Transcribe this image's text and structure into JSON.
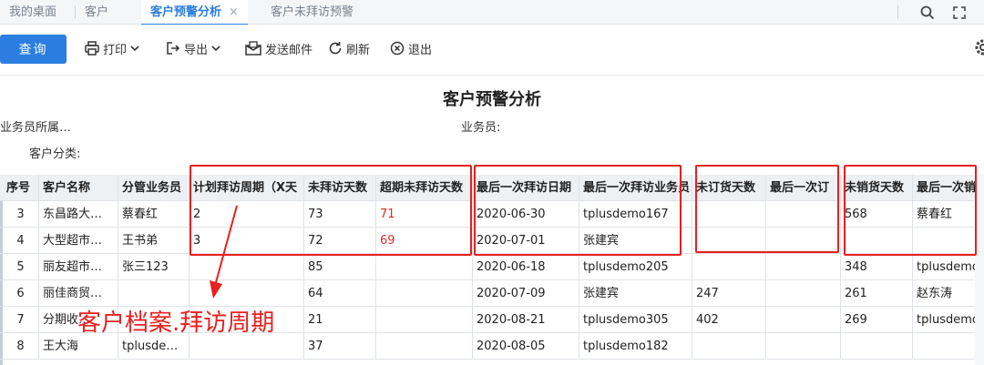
{
  "tabs": [
    {
      "label": "我的桌面",
      "active": false
    },
    {
      "label": "客户",
      "active": false
    },
    {
      "label": "客户预警分析",
      "active": true,
      "closable": true
    },
    {
      "label": "客户未拜访预警",
      "active": false
    }
  ],
  "tab_close_glyph": "×",
  "toolbar": {
    "query_label": "查询",
    "print_label": "打印",
    "export_label": "导出",
    "send_mail_label": "发送邮件",
    "refresh_label": "刷新",
    "exit_label": "退出"
  },
  "report": {
    "title": "客户预警分析",
    "filter_salesman_dept": "业务员所属…",
    "filter_salesman": "业务员:",
    "filter_customer_category": "客户分类:"
  },
  "table": {
    "headers": [
      "序号",
      "客户名称",
      "分管业务员",
      "计划拜访周期（X天",
      "未拜访天数",
      "超期未拜访天数",
      "最后一次拜访日期",
      "最后一次拜访业务员",
      "未订货天数",
      "最后一次订",
      "未销货天数",
      "最后一次销"
    ],
    "rows": [
      [
        "3",
        "东昌路大…",
        "蔡春红",
        "2",
        "73",
        "71",
        "2020-06-30",
        "tplusdemo167",
        "",
        "",
        "568",
        "蔡春红"
      ],
      [
        "4",
        "大型超市…",
        "王书弟",
        "3",
        "72",
        "69",
        "2020-07-01",
        "张建宾",
        "",
        "",
        "",
        ""
      ],
      [
        "5",
        "丽友超市…",
        "张三123",
        "",
        "85",
        "",
        "2020-06-18",
        "tplusdemo205",
        "",
        "",
        "348",
        "tplusdemo"
      ],
      [
        "6",
        "丽佳商贸…",
        "",
        "",
        "64",
        "",
        "2020-07-09",
        "张建宾",
        "247",
        "",
        "261",
        "赵东涛"
      ],
      [
        "7",
        "分期收…",
        "",
        "",
        "21",
        "",
        "2020-08-21",
        "tplusdemo305",
        "402",
        "",
        "269",
        "tplusdemo"
      ],
      [
        "8",
        "王大海",
        "tplusde…",
        "",
        "37",
        "",
        "2020-08-05",
        "tplusdemo182",
        "",
        "",
        "",
        ""
      ]
    ]
  },
  "annotation": {
    "text": "客户档案.拜访周期",
    "color": "#e8201f"
  },
  "colors": {
    "accent": "#2b7de0",
    "warning_text": "#e02a2a",
    "header_bg": "#eef1f4"
  },
  "icons": [
    "search-icon",
    "fullscreen-icon",
    "print-icon",
    "export-icon",
    "mail-icon",
    "refresh-icon",
    "exit-icon",
    "settings-gear-icon"
  ]
}
